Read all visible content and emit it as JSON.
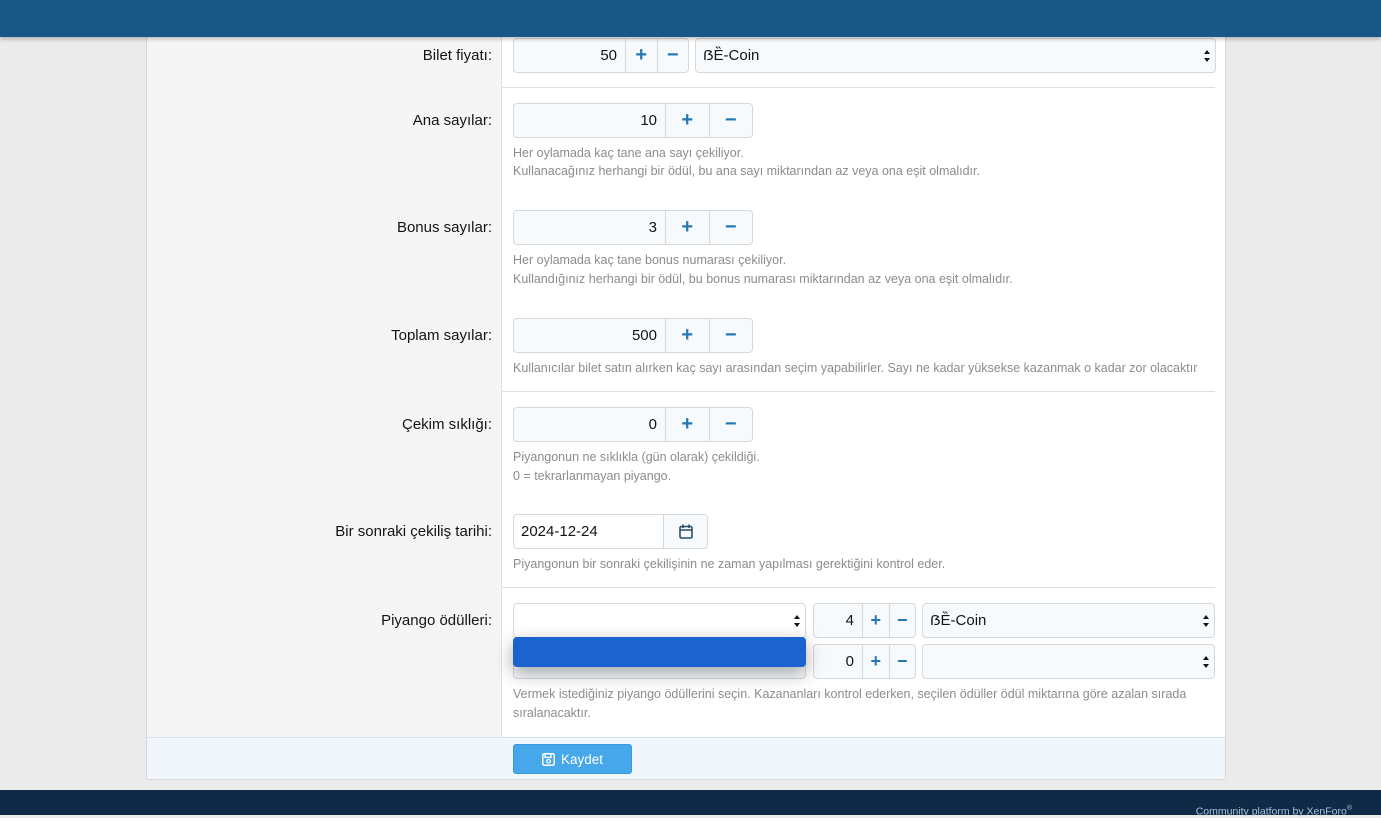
{
  "colors": {
    "header": "#185886",
    "footer": "#0f2a46",
    "accent": "#2577b1",
    "save_button": "#47a7eb",
    "dropdown_highlight": "#1c63d0"
  },
  "form": {
    "ticket_price": {
      "label": "Bilet fiyatı:",
      "value": "50",
      "currency": "ẞȄ-Coin"
    },
    "main_numbers": {
      "label": "Ana sayılar:",
      "value": "10",
      "hint_line1": "Her oylamada kaç tane ana sayı çekiliyor.",
      "hint_line2": "Kullanacağınız herhangi bir ödül, bu ana sayı miktarından az veya ona eşit olmalıdır."
    },
    "bonus_numbers": {
      "label": "Bonus sayılar:",
      "value": "3",
      "hint_line1": "Her oylamada kaç tane bonus numarası çekiliyor.",
      "hint_line2": "Kullandığınız herhangi bir ödül, bu bonus numarası miktarından az veya ona eşit olmalıdır."
    },
    "total_numbers": {
      "label": "Toplam sayılar:",
      "value": "500",
      "hint": "Kullanıcılar bilet satın alırken kaç sayı arasından seçim yapabilirler. Sayı ne kadar yüksekse kazanmak o kadar zor olacaktır"
    },
    "draw_frequency": {
      "label": "Çekim sıklığı:",
      "value": "0",
      "hint_line1": "Piyangonun ne sıklıkla (gün olarak) çekildiği.",
      "hint_line2": "0 = tekrarlanmayan piyango."
    },
    "next_draw_date": {
      "label": "Bir sonraki çekiliş tarihi:",
      "value": "2024-12-24",
      "hint": "Piyangonun bir sonraki çekilişinin ne zaman yapılması gerektiğini kontrol eder."
    },
    "prizes": {
      "label": "Piyango ödülleri:",
      "rows": [
        {
          "prize": "",
          "amount": "4",
          "currency": "ẞȄ-Coin"
        },
        {
          "prize": "",
          "amount": "0",
          "currency": ""
        }
      ],
      "hint_line1": "Vermek istediğiniz piyango ödüllerini seçin. Kazananları kontrol ederken, seçilen ödüller ödül miktarına göre azalan sırada",
      "hint_line2": "sıralanacaktır."
    }
  },
  "actions": {
    "save_label": "Kaydet",
    "save_icon": "floppy-disk-icon"
  },
  "footer": {
    "credit": "Community platform by XenForo",
    "credit_mark": "®"
  }
}
